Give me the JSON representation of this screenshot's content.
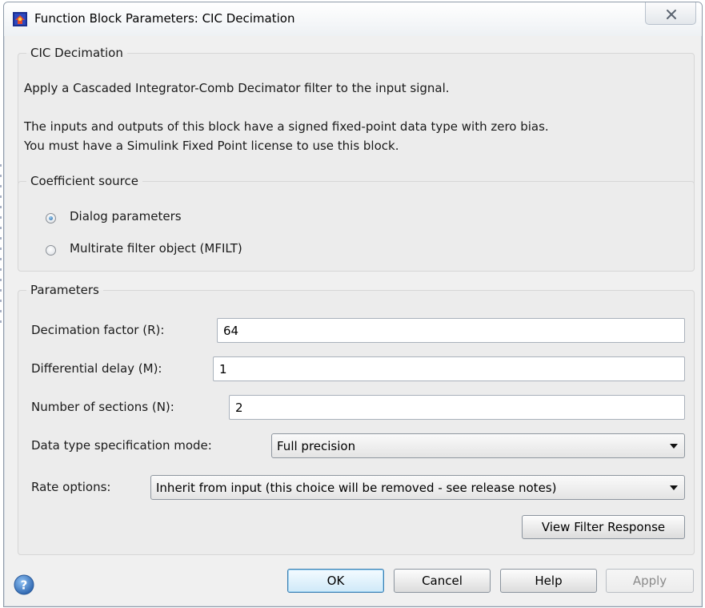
{
  "window": {
    "title": "Function Block Parameters: CIC Decimation"
  },
  "cic_group": {
    "legend": "CIC Decimation",
    "description_line1": "Apply a Cascaded Integrator-Comb Decimator filter to the input signal.",
    "description_line2": "The inputs and outputs of this block have a signed fixed-point data type with zero bias.",
    "description_line3": "You must have a Simulink Fixed Point license to use this block."
  },
  "coef_group": {
    "legend": "Coefficient source",
    "options": [
      {
        "label": "Dialog parameters",
        "selected": true
      },
      {
        "label": "Multirate filter object (MFILT)",
        "selected": false
      }
    ]
  },
  "params_group": {
    "legend": "Parameters",
    "decimation_factor": {
      "label": "Decimation factor (R):",
      "value": "64"
    },
    "differential_delay": {
      "label": "Differential delay (M):",
      "value": "1"
    },
    "number_of_sections": {
      "label": "Number of sections (N):",
      "value": "2"
    },
    "data_type_mode": {
      "label": "Data type specification mode:",
      "selected": "Full precision"
    },
    "rate_options": {
      "label": "Rate options:",
      "selected": "Inherit from input (this choice will be removed - see release notes)"
    },
    "view_filter_response_label": "View Filter Response"
  },
  "footer": {
    "ok_label": "OK",
    "cancel_label": "Cancel",
    "help_label": "Help",
    "apply_label": "Apply"
  },
  "icons": {
    "app": "simulink-block-icon",
    "close": "close-icon",
    "help": "help-icon"
  },
  "colors": {
    "window_bg": "#f0f0f0",
    "group_bg": "#ececec",
    "default_button_border": "#3c7fb1",
    "help_icon_blue": "#2f67b0"
  }
}
